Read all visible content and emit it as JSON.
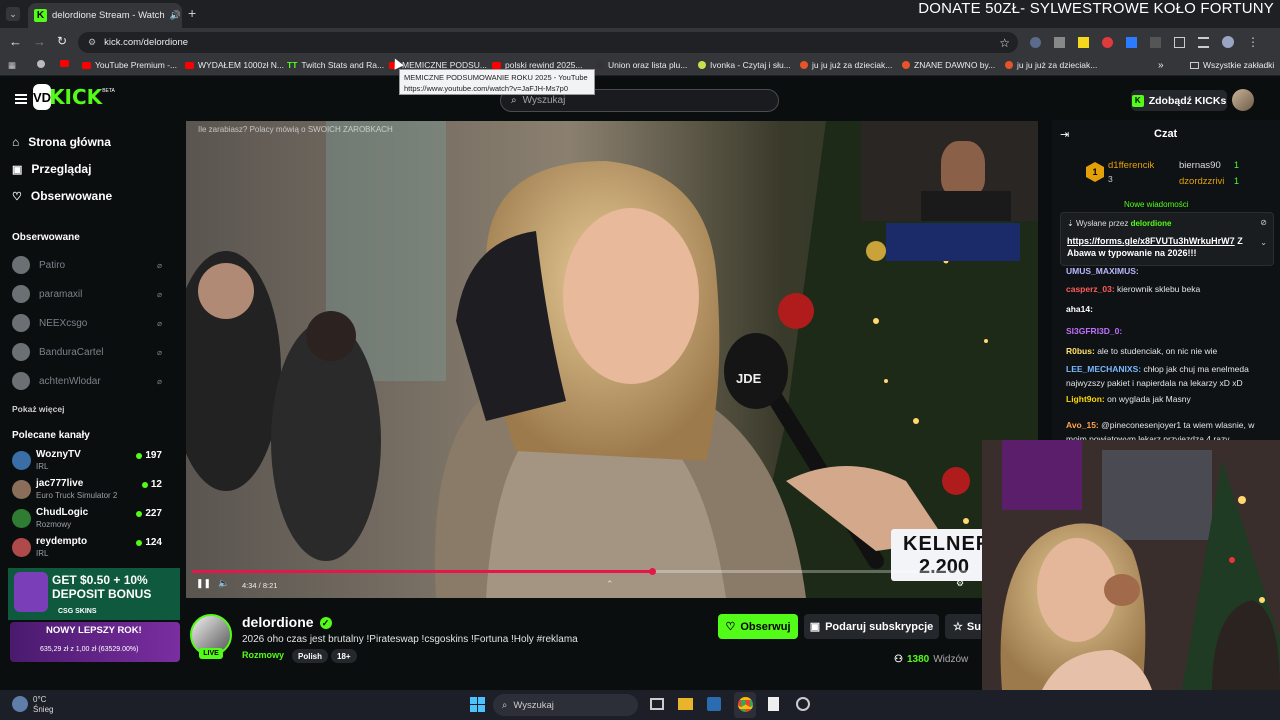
{
  "browser": {
    "tab_title": "delordione Stream - Watch",
    "donate_text": "DONATE 50ZŁ- SYLWESTROWE KOŁO FORTUNY",
    "url": "kick.com/delordione",
    "tooltip_title": "MEMICZNE PODSUMOWANIE ROKU 2025 - YouTube",
    "tooltip_url": "https://www.youtube.com/watch?v=JaFJH-Ms7p0",
    "bookmarks": [
      "YouTube Premium -...",
      "WYDAŁEM 1000zł N...",
      "Twitch Stats and Ra...",
      "MEMICZNE PODSU...",
      "polski rewind 2025...",
      "Union oraz lista plu...",
      "Ivonka - Czytaj i słu...",
      "ju ju już za dzieciak...",
      "ZNANE DAWNO by...",
      "ju ju już za dzieciak..."
    ],
    "all_bookmarks": "Wszystkie zakładki"
  },
  "header": {
    "logo": "KICK",
    "beta": "BETA",
    "search_placeholder": "Wyszukaj",
    "kicks_button": "Zdobądź KICKs"
  },
  "sidebar": {
    "nav": [
      {
        "label": "Strona główna",
        "icon": "home-icon"
      },
      {
        "label": "Przeglądaj",
        "icon": "browse-icon"
      },
      {
        "label": "Obserwowane",
        "icon": "heart-icon"
      }
    ],
    "followed_title": "Obserwowane",
    "followed": [
      "Patiro",
      "paramaxil",
      "NEEXcsgo",
      "BanduraCartel",
      "achtenWlodar"
    ],
    "show_more": "Pokaż więcej",
    "recommended_title": "Polecane kanały",
    "recommended": [
      {
        "name": "WoznyTV",
        "category": "IRL",
        "viewers": "197"
      },
      {
        "name": "jac777live",
        "category": "Euro Truck Simulator 2",
        "viewers": "12"
      },
      {
        "name": "ChudLogic",
        "category": "Rozmowy",
        "viewers": "227"
      },
      {
        "name": "reydempto",
        "category": "IRL",
        "viewers": "124"
      }
    ]
  },
  "promo": {
    "line1": "GET $0.50 + 10%",
    "line2": "DEPOSIT BONUS",
    "brand": "CSG SKINS",
    "banner": "NOWY LEPSZY ROK!",
    "stat": "635,29 zł z 1,00 zł (63529.00%)"
  },
  "video": {
    "caption": "Ile zarabiasz? Polacy mówią o SWOICH ZAROBKACH",
    "mic_label": "JDE",
    "overlay_line1": "KELNER",
    "overlay_line2": "2.200",
    "time": "4:34 / 8:21",
    "progress": 0.59
  },
  "channel": {
    "name": "delordione",
    "title": "2026 oho czas jest brutalny !Pirateswap !csgoskins !Fortuna !Holy #reklama",
    "category": "Rozmowy",
    "tags": [
      "Polish",
      "18+"
    ],
    "live": "LIVE",
    "follow_button": "Obserwuj",
    "gift_button": "Podaruj subskrypcje",
    "sub_button": "Su",
    "viewers": "1380",
    "viewers_label": "Widzów"
  },
  "chat": {
    "title": "Czat",
    "top_gifters": [
      {
        "name": "d1fferencik",
        "count": "3"
      },
      {
        "name": "biernas90",
        "count": "1"
      },
      {
        "name": "dzordzzrivi",
        "count": "1"
      }
    ],
    "new_messages": "Nowe wiadomości",
    "pinned_by_label": "Wysłane przez",
    "pinned_by": "delordione",
    "pinned_link": "https://forms.gle/x8FVUTu3hWrkuHrW7",
    "pinned_text": "ZAbawa w typowanie na 2026!!!",
    "messages": [
      {
        "user": "UMUS_MAXIMUS:",
        "text": "",
        "color": "#b8b8ff"
      },
      {
        "user": "casperz_03:",
        "text": "kierownik sklebu beka",
        "color": "#ff5b5b"
      },
      {
        "user": "aha14:",
        "text": "",
        "color": "#ffffff"
      },
      {
        "user": "SI3GFRI3D_0:",
        "text": "",
        "color": "#c070ff"
      },
      {
        "user": "R0bus:",
        "text": "ale to studenciak, on nic nie wie",
        "color": "#ffe066"
      },
      {
        "user": "LEE_MECHANIXS:",
        "text": "chłop jak chuj ma enelmeda najwyzszy pakiet i napierdala na lekarzy xD xD",
        "color": "#7ab8ff"
      },
      {
        "user": "Light9on:",
        "text": "on wyglada jak Masny",
        "color": "#ffd700"
      },
      {
        "user": "Avo_15:",
        "text": "@pineconesenjoyer1 ta wiem wlasnie, w moim powiatowym lekarz przyjezdza 4 razy",
        "color": "#ffa24d"
      }
    ]
  },
  "taskbar": {
    "weather_temp": "0°C",
    "weather_desc": "Śnieg",
    "search": "Wyszukaj"
  },
  "colors": {
    "accent": "#53fc18",
    "bg": "#0b0e0f",
    "progress": "#e5164b"
  }
}
